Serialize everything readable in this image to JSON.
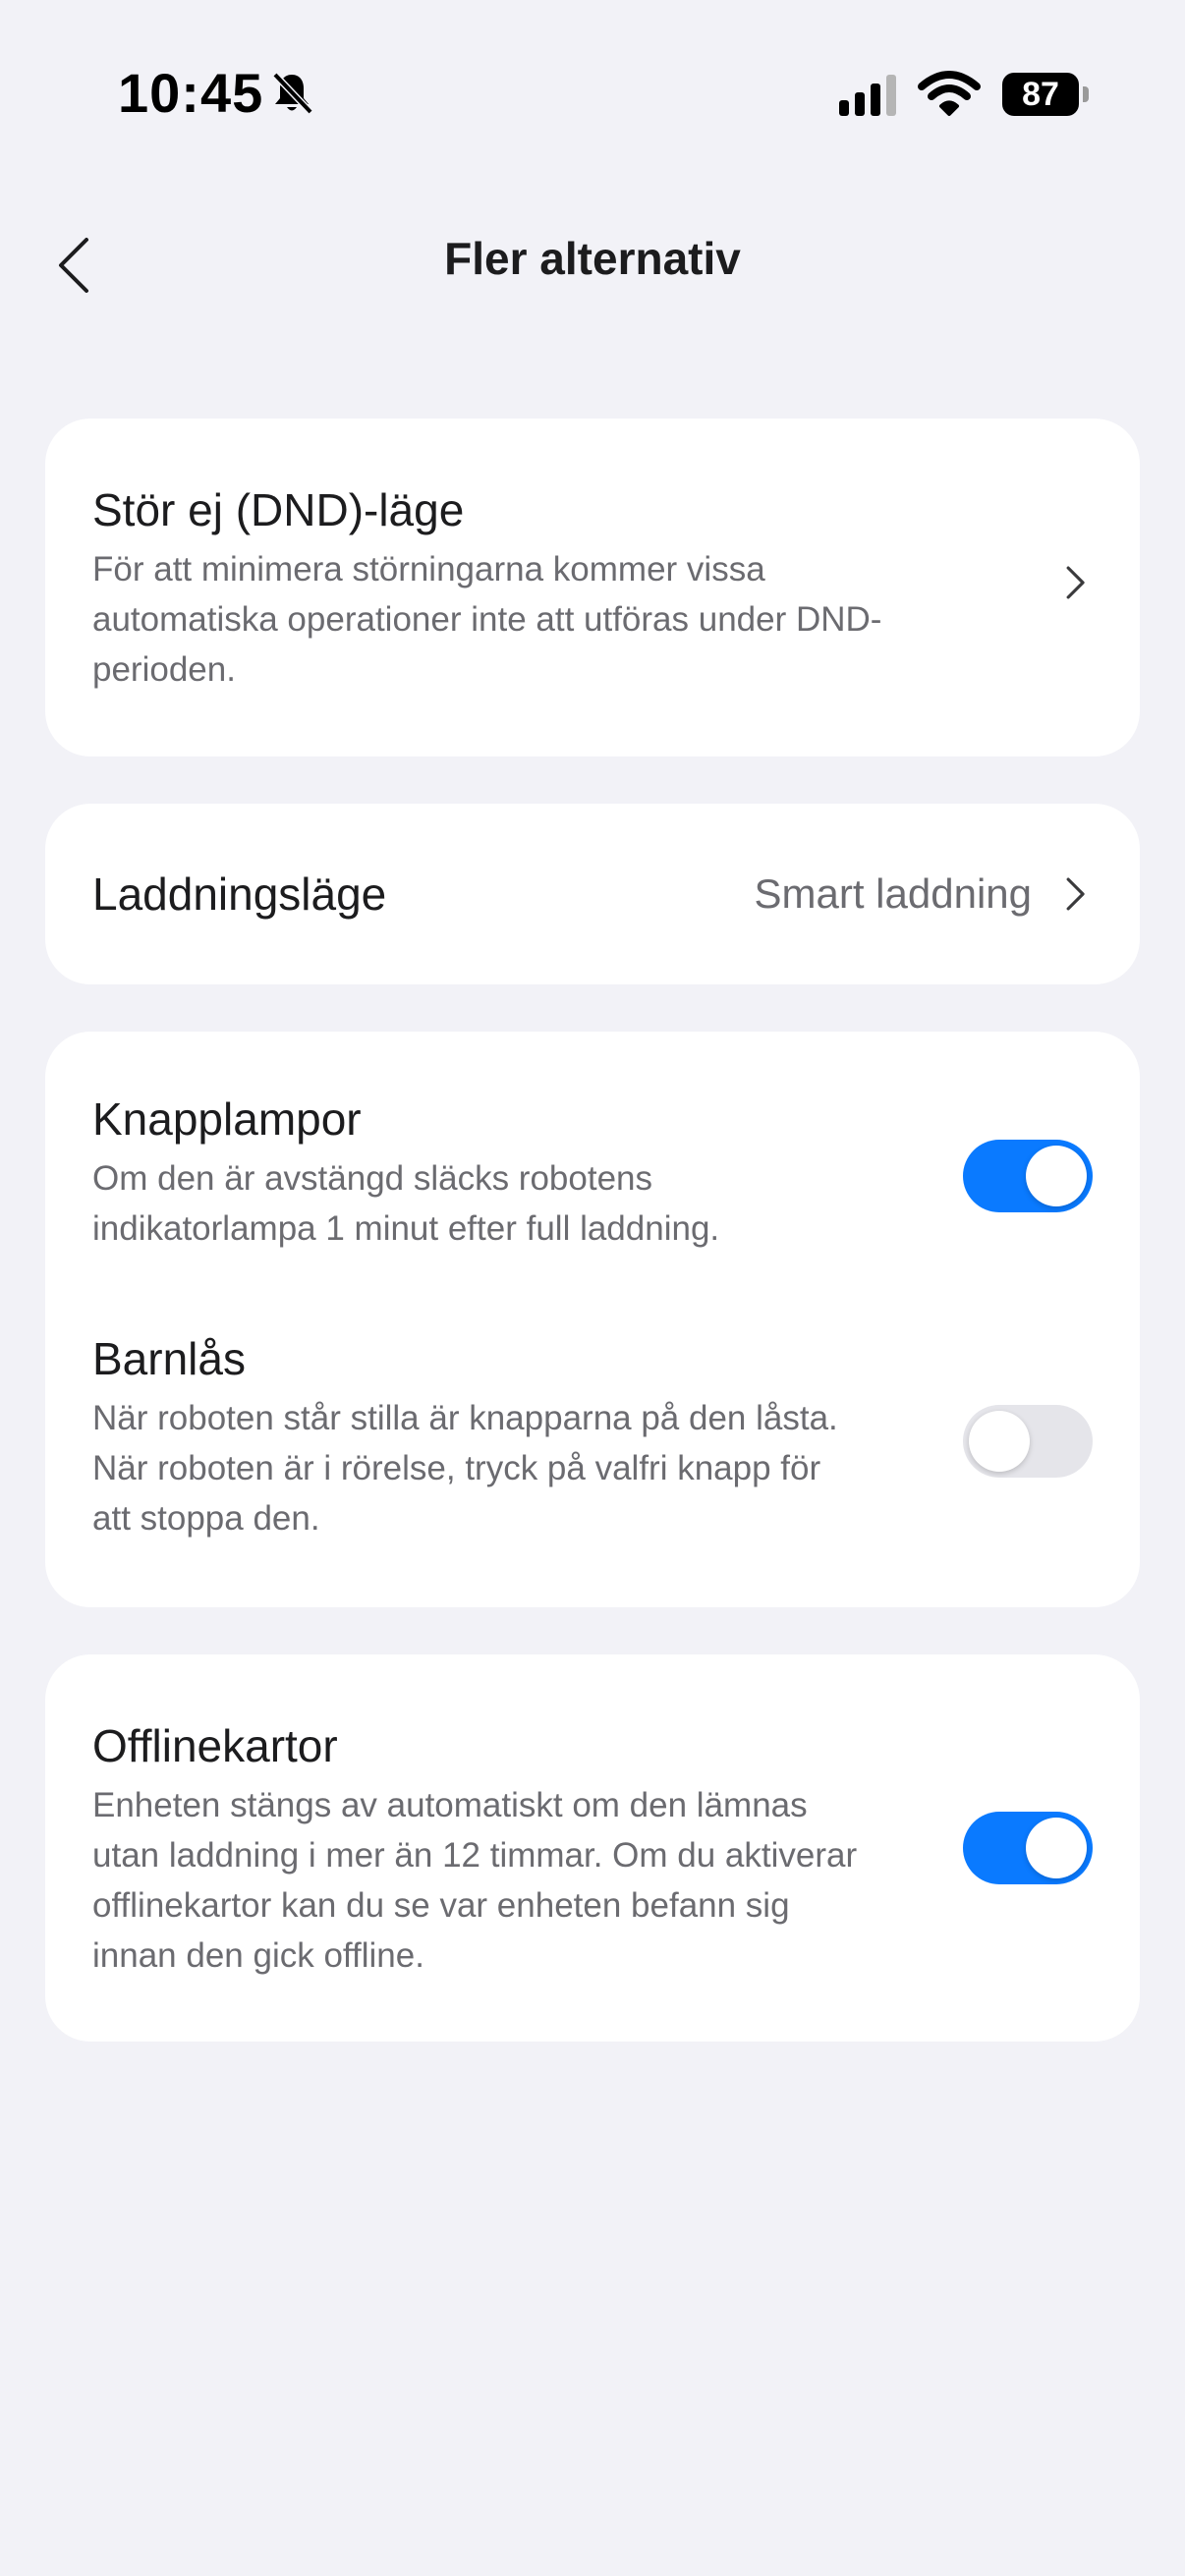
{
  "status_bar": {
    "time": "10:45",
    "battery_level": "87",
    "silent_icon": "bell-slash-icon",
    "signal_icon": "cellular-signal-icon",
    "wifi_icon": "wifi-icon"
  },
  "nav": {
    "title": "Fler alternativ",
    "back_icon": "chevron-left-icon"
  },
  "dnd": {
    "title": "Stör ej (DND)-läge",
    "desc_line1": "För att minimera störningarna kommer vissa",
    "desc_line2": "automatiska operationer inte att utföras under DND-",
    "desc_line3": "perioden."
  },
  "charging": {
    "title": "Laddningsläge",
    "value": "Smart laddning"
  },
  "button_lights": {
    "title": "Knapplampor",
    "desc_line1": "Om den är avstängd släcks robotens",
    "desc_line2": "indikatorlampa 1 minut efter full laddning.",
    "enabled": true
  },
  "child_lock": {
    "title": "Barnlås",
    "desc_line1": "När roboten står stilla är knapparna på den låsta.",
    "desc_line2": "När roboten är i rörelse, tryck på valfri knapp för",
    "desc_line3": "att stoppa den.",
    "enabled": false
  },
  "offline_maps": {
    "title": "Offlinekartor",
    "desc_line1": "Enheten stängs av automatiskt om den lämnas",
    "desc_line2": "utan laddning i mer än 12 timmar. Om du aktiverar",
    "desc_line3": "offlinekartor kan du se var enheten befann sig",
    "desc_line4": "innan den gick offline.",
    "enabled": true
  },
  "colors": {
    "background": "#f2f2f7",
    "card": "#ffffff",
    "toggle_on": "#0a7aff",
    "toggle_off": "#e5e5ea",
    "secondary_text": "#6b6b70"
  }
}
